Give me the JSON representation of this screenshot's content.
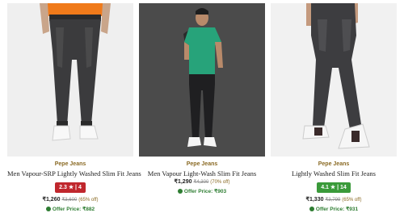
{
  "products": [
    {
      "brand": "Pepe Jeans",
      "name": "Men Vapour-SRP Lightly Washed Slim Fit Jeans",
      "rating": "2.3 ★ | 4",
      "rating_color": "#c0272d",
      "price": "₹1,260",
      "mrp": "₹3,600",
      "discount": "(65% off)",
      "offer": "Offer Price: ₹882"
    },
    {
      "brand": "Pepe Jeans",
      "name": "Men Vapour Light-Wash Slim Fit Jeans",
      "price": "₹1,290",
      "mrp": "₹4,300",
      "discount": "(70% off)",
      "offer": "Offer Price: ₹903"
    },
    {
      "brand": "Pepe Jeans",
      "name": "Lightly Washed Slim Fit Jeans",
      "rating": "4.1 ★ | 14",
      "rating_color": "#3a9a3a",
      "price": "₹1,330",
      "mrp": "₹3,799",
      "discount": "(65% off)",
      "offer": "Offer Price: ₹931"
    }
  ],
  "colors": {
    "brand_text": "#8a6a24",
    "offer_green": "#2e7d32",
    "jeans_dark": "#3a3a3a"
  }
}
